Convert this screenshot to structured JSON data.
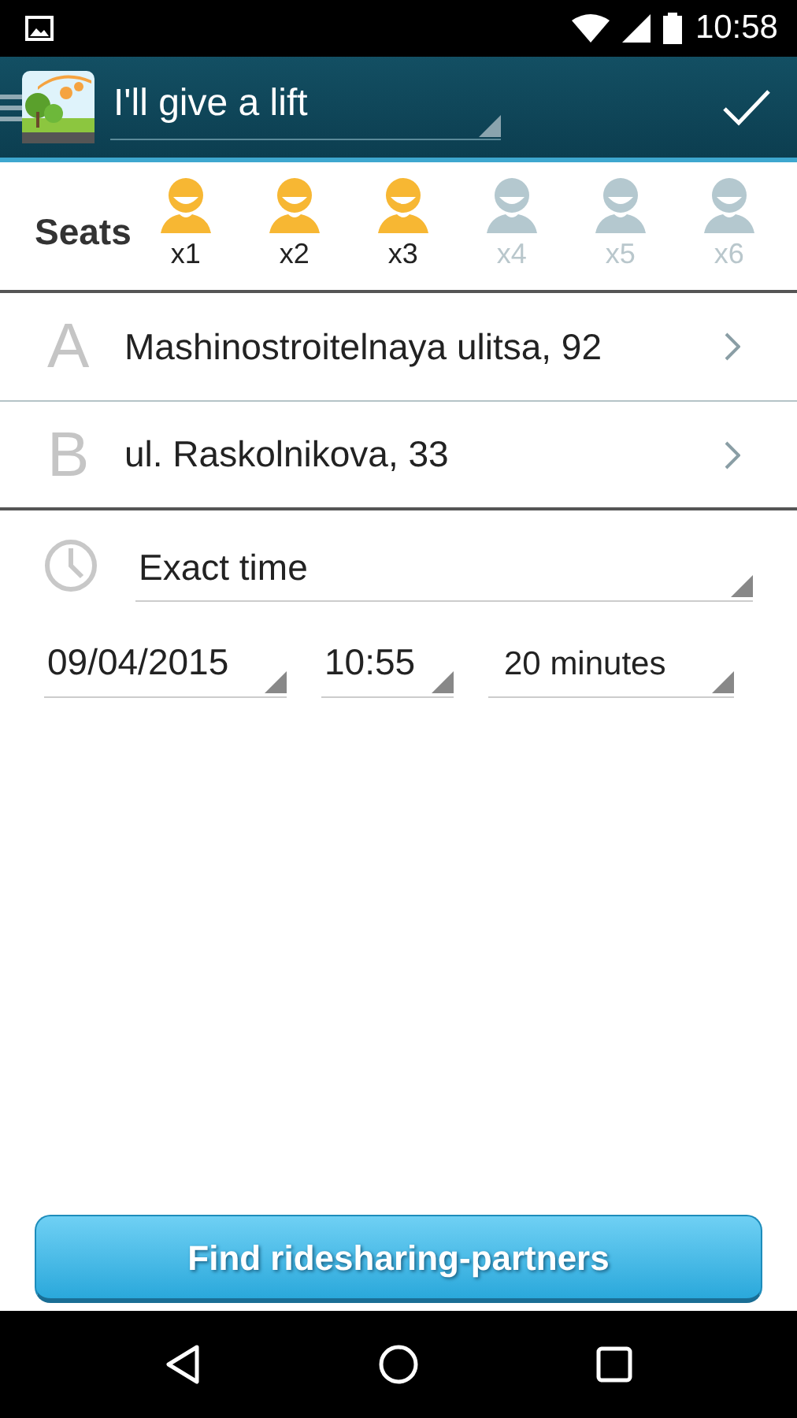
{
  "status_bar": {
    "time": "10:58"
  },
  "app_bar": {
    "title": "I'll give a lift"
  },
  "seats": {
    "label": "Seats",
    "options": [
      {
        "label": "x1",
        "selected": true
      },
      {
        "label": "x2",
        "selected": true
      },
      {
        "label": "x3",
        "selected": true
      },
      {
        "label": "x4",
        "selected": false
      },
      {
        "label": "x5",
        "selected": false
      },
      {
        "label": "x6",
        "selected": false
      }
    ]
  },
  "route": [
    {
      "letter": "A",
      "address": "Mashinostroitelnaya ulitsa, 92"
    },
    {
      "letter": "B",
      "address": "ul. Raskolnikova, 33"
    }
  ],
  "time_mode": "Exact time",
  "date": "09/04/2015",
  "time": "10:55",
  "tolerance": "20 minutes",
  "find_button": "Find ridesharing-partners"
}
